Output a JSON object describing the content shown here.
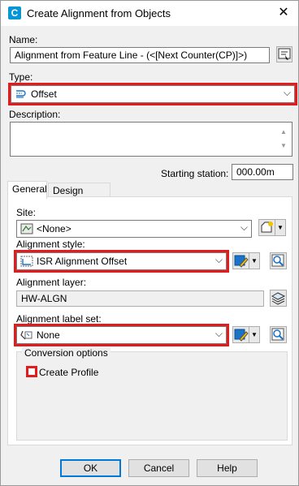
{
  "window": {
    "title": "Create Alignment from Objects",
    "app_icon": "C"
  },
  "name": {
    "label": "Name:",
    "value": "Alignment from Feature Line - (<[Next Counter(CP)]>)"
  },
  "type": {
    "label": "Type:",
    "value": "Offset"
  },
  "description": {
    "label": "Description:",
    "value": ""
  },
  "station": {
    "label": "Starting station:",
    "value": "000.00m"
  },
  "tabs": [
    {
      "label": "General"
    },
    {
      "label": "Design Criteria"
    }
  ],
  "site": {
    "label": "Site:",
    "value": "<None>"
  },
  "alignment_style": {
    "label": "Alignment style:",
    "value": "ISR Alignment Offset"
  },
  "alignment_layer": {
    "label": "Alignment layer:",
    "value": "HW-ALGN"
  },
  "label_set": {
    "label": "Alignment label set:",
    "value": "None"
  },
  "conversion": {
    "title": "Conversion options",
    "create_profile_label": "Create Profile",
    "create_profile_checked": false
  },
  "buttons": {
    "ok": "OK",
    "cancel": "Cancel",
    "help": "Help"
  },
  "colors": {
    "highlight": "#e21c1c",
    "accent": "#0078d7"
  }
}
